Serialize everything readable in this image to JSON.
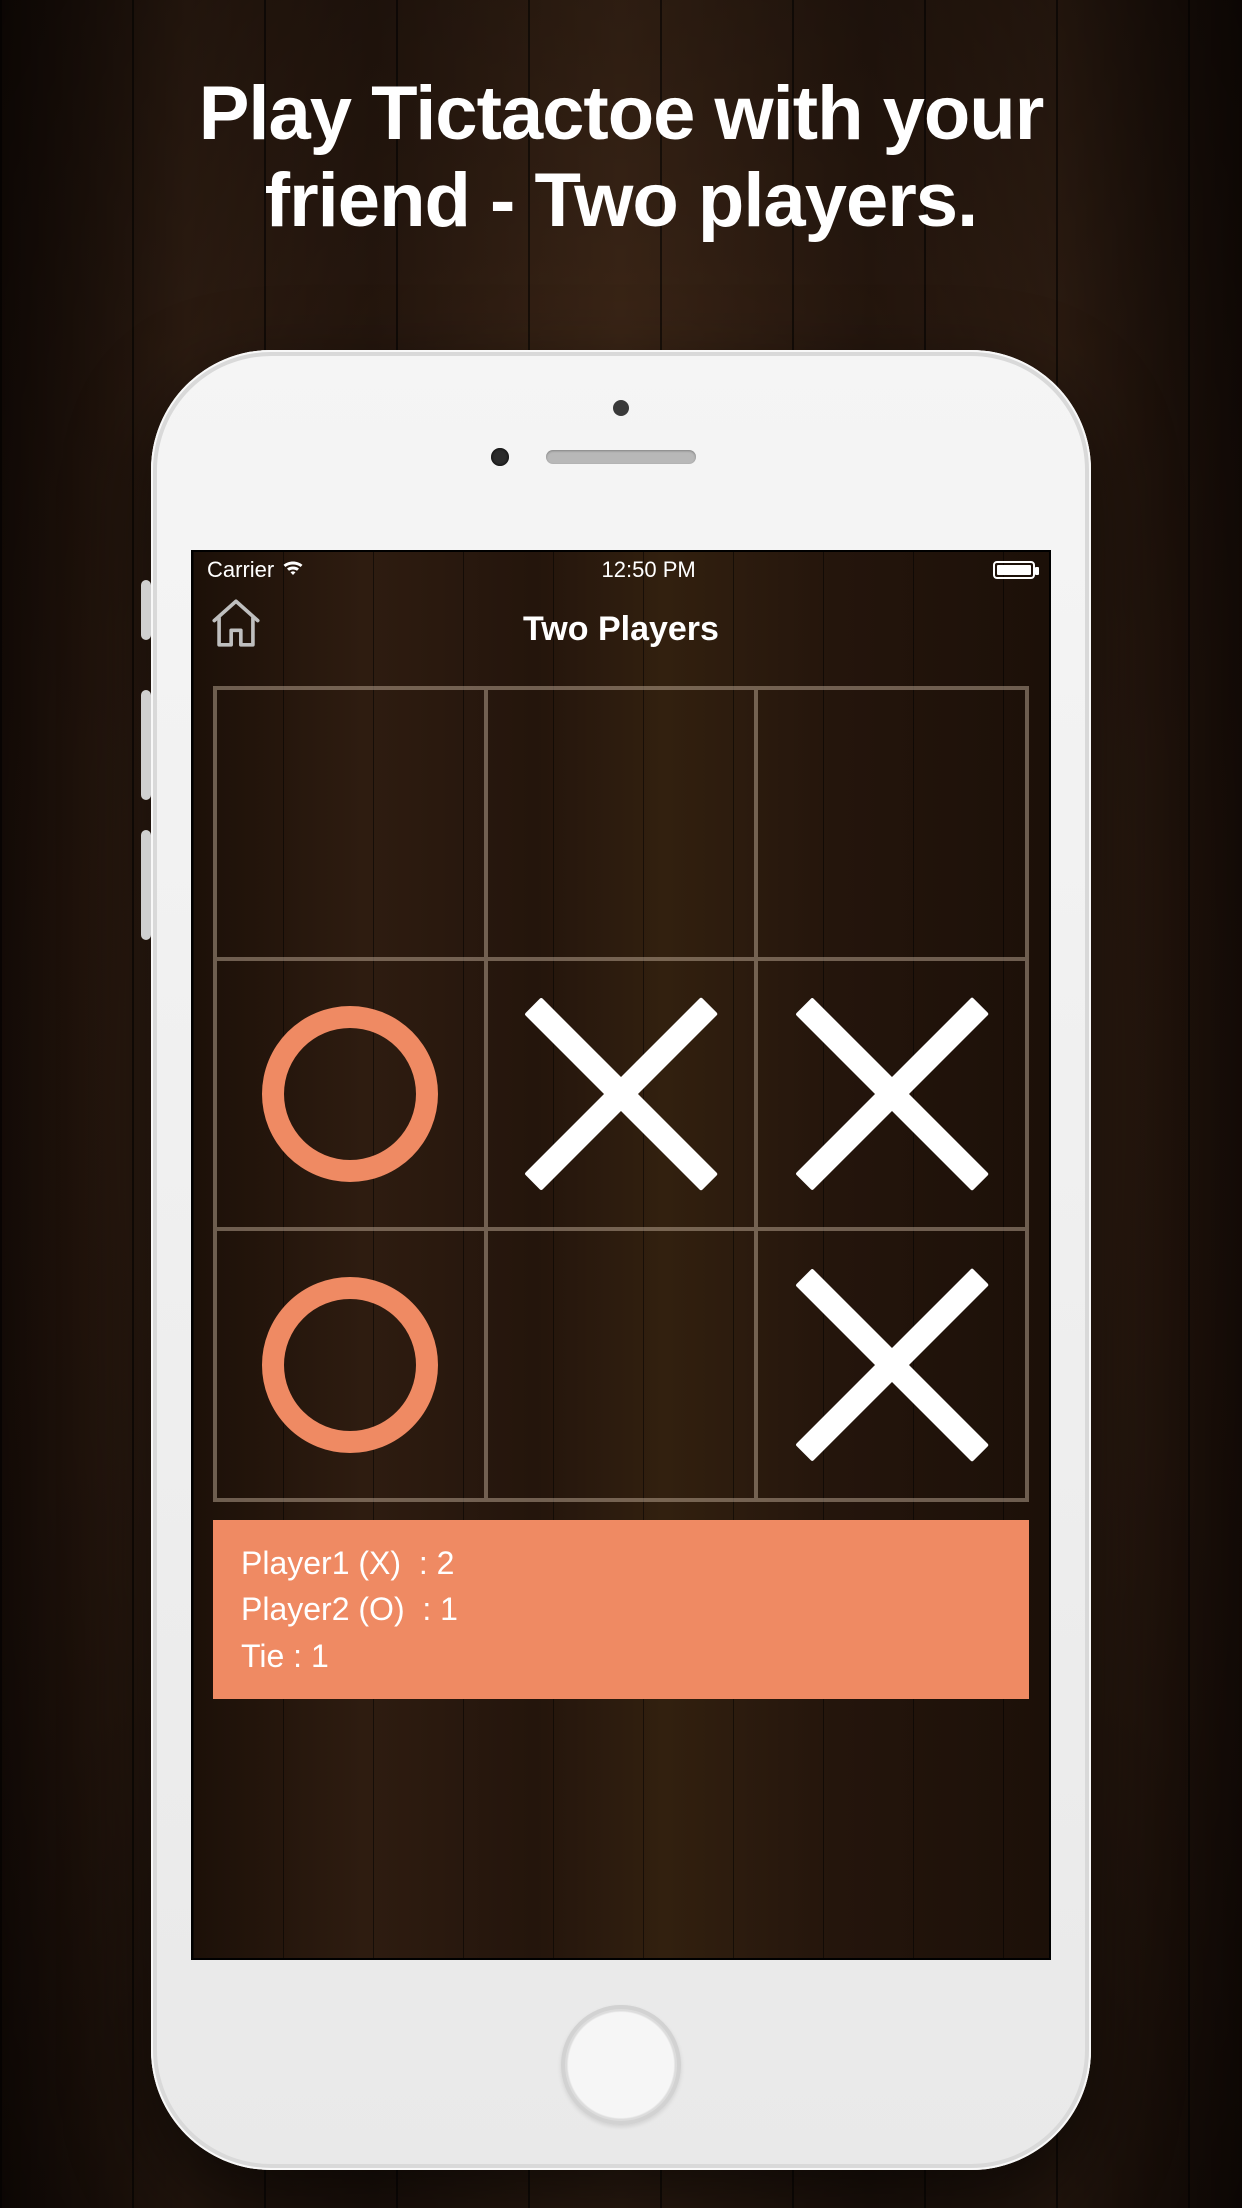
{
  "promo": {
    "headline": "Play Tictactoe with your\nfriend - Two players."
  },
  "status_bar": {
    "carrier": "Carrier",
    "time": "12:50 PM"
  },
  "nav": {
    "title": "Two Players"
  },
  "board": {
    "cells": [
      "",
      "",
      "",
      "O",
      "X",
      "X",
      "O",
      "",
      "X"
    ]
  },
  "score": {
    "player1_label": "Player1 (X)  : 2",
    "player2_label": "Player2 (O)  : 1",
    "tie_label": "Tie : 1"
  },
  "colors": {
    "accent": "#ef8a63"
  }
}
